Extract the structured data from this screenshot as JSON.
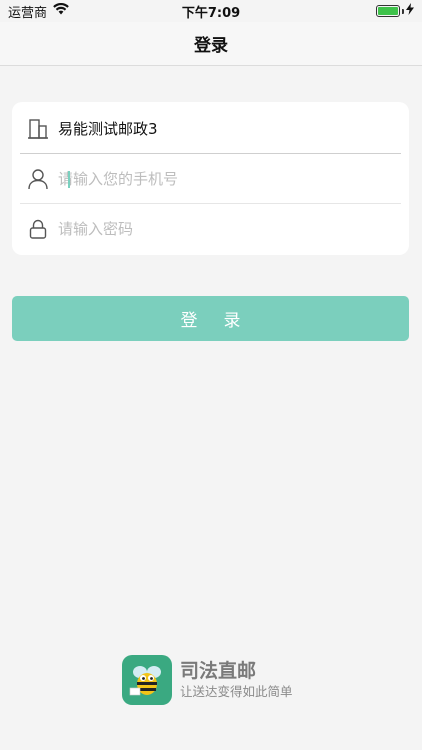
{
  "status_bar": {
    "carrier": "运营商",
    "time": "下午7:09",
    "battery_level": 1.0,
    "wifi_icon": "wifi-icon"
  },
  "nav": {
    "title": "登录"
  },
  "form": {
    "organization": {
      "icon": "building-icon",
      "value": "易能测试邮政3"
    },
    "phone": {
      "icon": "user-icon",
      "value": "",
      "placeholder": "请输入您的手机号"
    },
    "password": {
      "icon": "lock-icon",
      "value": "",
      "placeholder": "请输入密码"
    }
  },
  "login_button": {
    "label": "登录",
    "color": "#7bcfbd"
  },
  "brand": {
    "name": "司法直邮",
    "slogan": "让送达变得如此简单",
    "logo_icon": "bee-logo-icon",
    "logo_color": "#3aa981"
  }
}
